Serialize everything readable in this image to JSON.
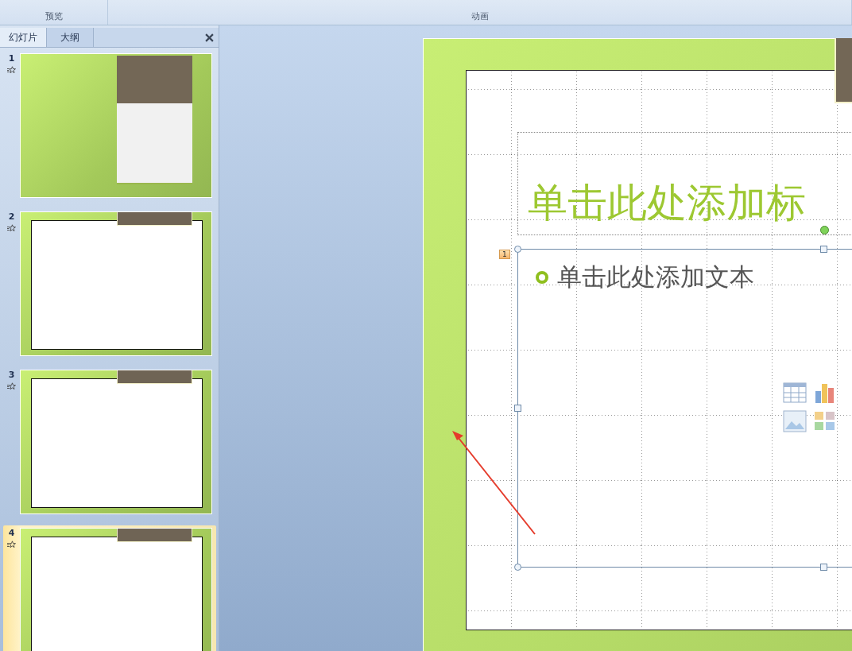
{
  "ribbon": {
    "groups": [
      "预览",
      "动画"
    ]
  },
  "panel": {
    "tabs": [
      {
        "label": "幻灯片",
        "selected": true
      },
      {
        "label": "大纲",
        "selected": false
      }
    ],
    "slides": [
      {
        "number": "1",
        "kind": "title",
        "selected": false
      },
      {
        "number": "2",
        "kind": "content",
        "selected": false
      },
      {
        "number": "3",
        "kind": "content",
        "selected": false
      },
      {
        "number": "4",
        "kind": "content",
        "selected": true
      }
    ]
  },
  "editor": {
    "title_placeholder": "单击此处添加标",
    "body_placeholder": "单击此处添加文本",
    "animation_tag": "1"
  }
}
